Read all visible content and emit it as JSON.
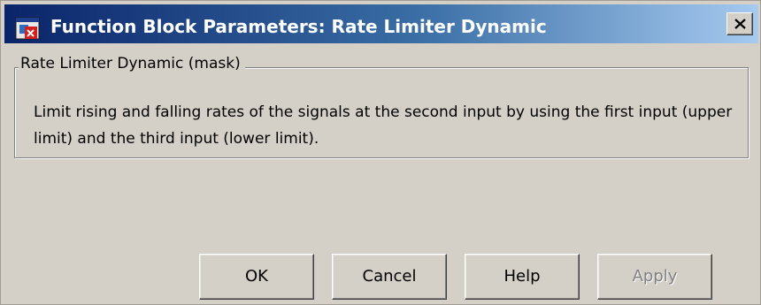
{
  "window": {
    "title": "Function Block Parameters: Rate Limiter Dynamic"
  },
  "mask": {
    "group_label": "Rate Limiter Dynamic (mask)",
    "description": "Limit rising and falling rates of the signals at the second input by using the first input (upper limit) and the third input (lower limit)."
  },
  "buttons": {
    "ok": "OK",
    "cancel": "Cancel",
    "help": "Help",
    "apply": "Apply"
  },
  "icons": {
    "app": "simulink-block-icon",
    "close": "close-icon"
  },
  "colors": {
    "titlebar_start": "#0a246a",
    "titlebar_end": "#a6caf0",
    "dialog_bg": "#d4d0c8",
    "disabled_text": "#808080"
  }
}
